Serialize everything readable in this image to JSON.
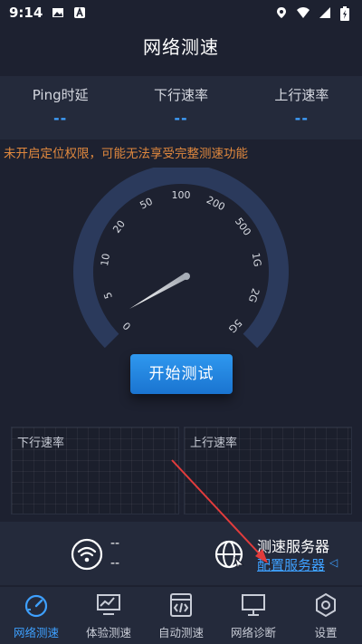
{
  "status_bar": {
    "time": "9:14"
  },
  "header": {
    "title": "网络测速"
  },
  "stats": [
    {
      "label": "Ping时延",
      "value": "--"
    },
    {
      "label": "下行速率",
      "value": "--"
    },
    {
      "label": "上行速率",
      "value": "--"
    }
  ],
  "warning": "未开启定位权限，可能无法享受完整测速功能",
  "gauge": {
    "ticks": [
      "0",
      "5",
      "10",
      "20",
      "50",
      "100",
      "200",
      "500",
      "1G",
      "2G",
      "5G"
    ],
    "needle_value": "0"
  },
  "start_button": "开始测试",
  "panels": {
    "download_label": "下行速率",
    "upload_label": "上行速率"
  },
  "network": {
    "line1": "--",
    "line2": "--"
  },
  "server": {
    "title": "测速服务器",
    "link": "配置服务器"
  },
  "tabs": [
    {
      "label": "网络测速",
      "icon": "speedometer-icon",
      "active": true
    },
    {
      "label": "体验测速",
      "icon": "chart-monitor-icon",
      "active": false
    },
    {
      "label": "自动测速",
      "icon": "code-file-icon",
      "active": false
    },
    {
      "label": "网络诊断",
      "icon": "monitor-icon",
      "active": false
    },
    {
      "label": "设置",
      "icon": "gear-hexagon-icon",
      "active": false
    }
  ],
  "colors": {
    "accent": "#3ea0ff",
    "warning": "#e0883e",
    "background": "#1d2130",
    "panel": "#242a3b",
    "annotation_arrow": "#e23c3c"
  }
}
